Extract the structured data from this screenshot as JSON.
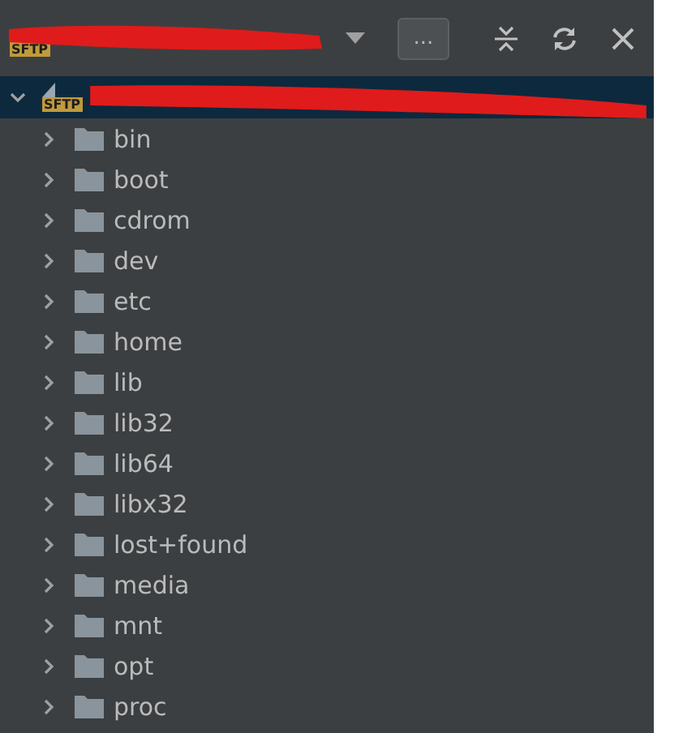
{
  "toolbar": {
    "badge": "SFTP",
    "more_label": "..."
  },
  "tree": {
    "badge": "SFTP",
    "expanded": true,
    "selected": true,
    "children": [
      {
        "label": "bin",
        "expanded": false
      },
      {
        "label": "boot",
        "expanded": false
      },
      {
        "label": "cdrom",
        "expanded": false
      },
      {
        "label": "dev",
        "expanded": false
      },
      {
        "label": "etc",
        "expanded": false
      },
      {
        "label": "home",
        "expanded": false
      },
      {
        "label": "lib",
        "expanded": false
      },
      {
        "label": "lib32",
        "expanded": false
      },
      {
        "label": "lib64",
        "expanded": false
      },
      {
        "label": "libx32",
        "expanded": false
      },
      {
        "label": "lost+found",
        "expanded": false
      },
      {
        "label": "media",
        "expanded": false
      },
      {
        "label": "mnt",
        "expanded": false
      },
      {
        "label": "opt",
        "expanded": false
      },
      {
        "label": "proc",
        "expanded": false
      }
    ]
  }
}
